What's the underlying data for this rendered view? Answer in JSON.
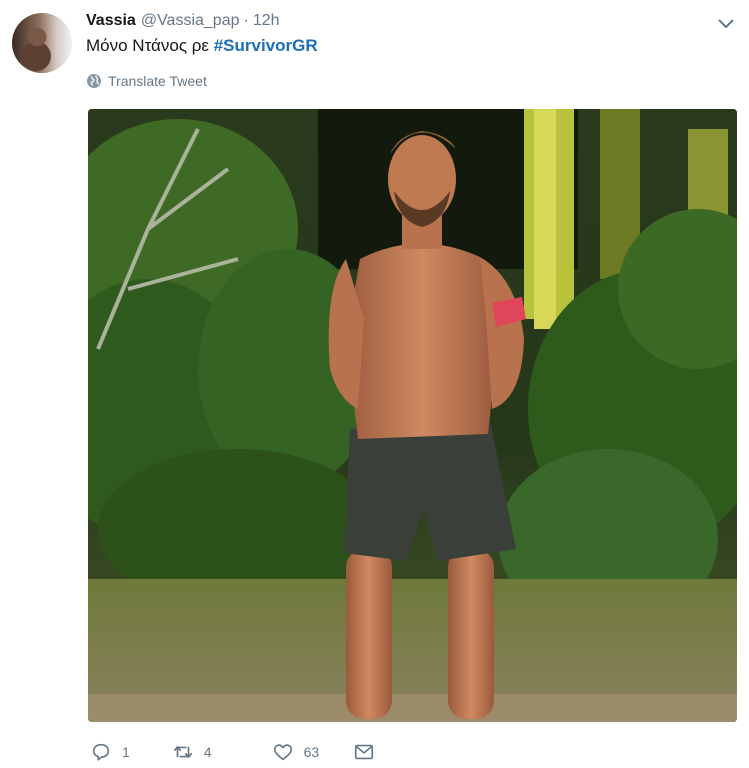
{
  "tweet": {
    "author_name": "Vassia",
    "author_handle": "@Vassia_pap",
    "separator": "·",
    "timestamp": "12h",
    "text_prefix": "Μόνο Ντάνος ρε ",
    "hashtag": "#SurvivorGR",
    "translate_label": "Translate Tweet"
  },
  "stats": {
    "replies": "1",
    "retweets": "4",
    "likes": "63"
  },
  "colors": {
    "hashtag": "#1b6fb5",
    "muted": "#657786"
  },
  "icons": [
    "chevron-down-icon",
    "globe-icon",
    "reply-icon",
    "retweet-icon",
    "like-icon",
    "message-icon"
  ]
}
